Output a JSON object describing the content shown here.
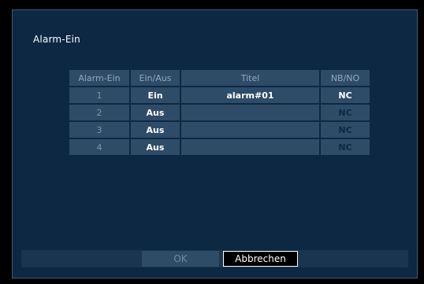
{
  "dialog": {
    "title": "Alarm-Ein"
  },
  "table": {
    "headers": {
      "alarm_in": "Alarm-Ein",
      "on_off": "Ein/Aus",
      "title": "Titel",
      "nb_no": "NB/NO"
    },
    "rows": [
      {
        "num": "1",
        "state": "Ein",
        "title": "alarm#01",
        "contact": "NC",
        "enabled": true
      },
      {
        "num": "2",
        "state": "Aus",
        "title": "",
        "contact": "NC",
        "enabled": false
      },
      {
        "num": "3",
        "state": "Aus",
        "title": "",
        "contact": "NC",
        "enabled": false
      },
      {
        "num": "4",
        "state": "Aus",
        "title": "",
        "contact": "NC",
        "enabled": false
      }
    ]
  },
  "buttons": {
    "ok": "OK",
    "cancel": "Abbrechen"
  },
  "colors": {
    "dialog_bg": "#0d2843",
    "cell_bg": "#2e4b67",
    "disabled_cell_bg": "#7d7871",
    "button_bar_bg": "#1a3550"
  }
}
